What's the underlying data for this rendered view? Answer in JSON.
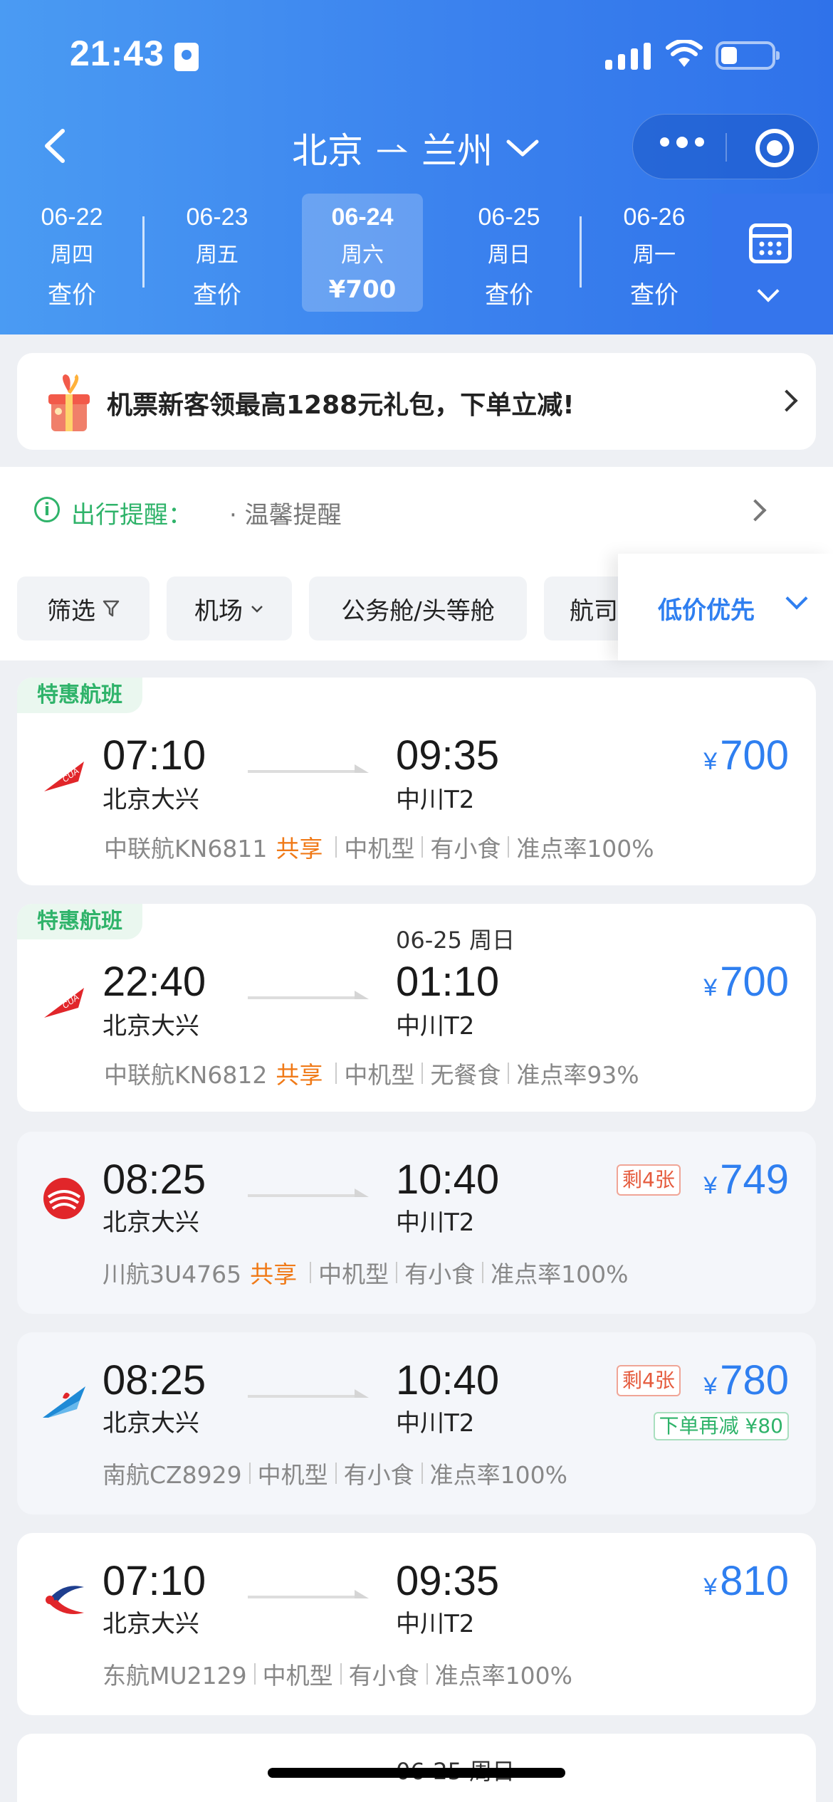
{
  "status_bar": {
    "time": "21:43"
  },
  "header": {
    "origin": "北京",
    "destination": "兰州",
    "dates": [
      {
        "date": "06-22",
        "weekday": "周四",
        "price": "查价",
        "active": false
      },
      {
        "date": "06-23",
        "weekday": "周五",
        "price": "查价",
        "active": false
      },
      {
        "date": "06-24",
        "weekday": "周六",
        "price": "¥700",
        "active": true
      },
      {
        "date": "06-25",
        "weekday": "周日",
        "price": "查价",
        "active": false
      },
      {
        "date": "06-26",
        "weekday": "周一",
        "price": "查价",
        "active": false
      }
    ]
  },
  "promo": {
    "text": "机票新客领最高1288元礼包，下单立减!"
  },
  "notice": {
    "label": "出行提醒：",
    "value": "· 温馨提醒"
  },
  "filters": {
    "chips": [
      "筛选",
      "机场",
      "公务舱/头等舱",
      "航司"
    ],
    "sort_label": "低价优先"
  },
  "flights": [
    {
      "special": "特惠航班",
      "dep_time": "07:10",
      "arr_time": "09:35",
      "next_day": "",
      "dep_airport": "北京大兴",
      "arr_airport": "中川T2",
      "price": "700",
      "seats_left": "",
      "discount": "",
      "flight_no": "中联航KN6811",
      "shared": "共享",
      "aircraft": "中机型",
      "meal": "有小食",
      "ontime": "准点率100%",
      "airline_logo": "cua-logo-icon"
    },
    {
      "special": "特惠航班",
      "dep_time": "22:40",
      "arr_time": "01:10",
      "next_day": "06-25 周日",
      "dep_airport": "北京大兴",
      "arr_airport": "中川T2",
      "price": "700",
      "seats_left": "",
      "discount": "",
      "flight_no": "中联航KN6812",
      "shared": "共享",
      "aircraft": "中机型",
      "meal": "无餐食",
      "ontime": "准点率93%",
      "airline_logo": "cua-logo-icon"
    },
    {
      "special": "",
      "dep_time": "08:25",
      "arr_time": "10:40",
      "next_day": "",
      "dep_airport": "北京大兴",
      "arr_airport": "中川T2",
      "price": "749",
      "seats_left": "剩4张",
      "discount": "",
      "flight_no": "川航3U4765",
      "shared": "共享",
      "aircraft": "中机型",
      "meal": "有小食",
      "ontime": "准点率100%",
      "airline_logo": "sichuan-airlines-logo-icon"
    },
    {
      "special": "",
      "dep_time": "08:25",
      "arr_time": "10:40",
      "next_day": "",
      "dep_airport": "北京大兴",
      "arr_airport": "中川T2",
      "price": "780",
      "seats_left": "剩4张",
      "discount": "下单再减 ¥80",
      "flight_no": "南航CZ8929",
      "shared": "",
      "aircraft": "中机型",
      "meal": "有小食",
      "ontime": "准点率100%",
      "airline_logo": "china-southern-logo-icon"
    },
    {
      "special": "",
      "dep_time": "07:10",
      "arr_time": "09:35",
      "next_day": "",
      "dep_airport": "北京大兴",
      "arr_airport": "中川T2",
      "price": "810",
      "seats_left": "",
      "discount": "",
      "flight_no": "东航MU2129",
      "shared": "",
      "aircraft": "中机型",
      "meal": "有小食",
      "ontime": "准点率100%",
      "airline_logo": "china-eastern-logo-icon"
    }
  ],
  "partial_card": {
    "next_day": "06-25 周日"
  },
  "colors": {
    "header_blue": "#3b82ee",
    "price_blue": "#2f7ff0",
    "special_green": "#2fb36a",
    "share_orange": "#f07a18",
    "seats_red": "#e55a3c"
  }
}
